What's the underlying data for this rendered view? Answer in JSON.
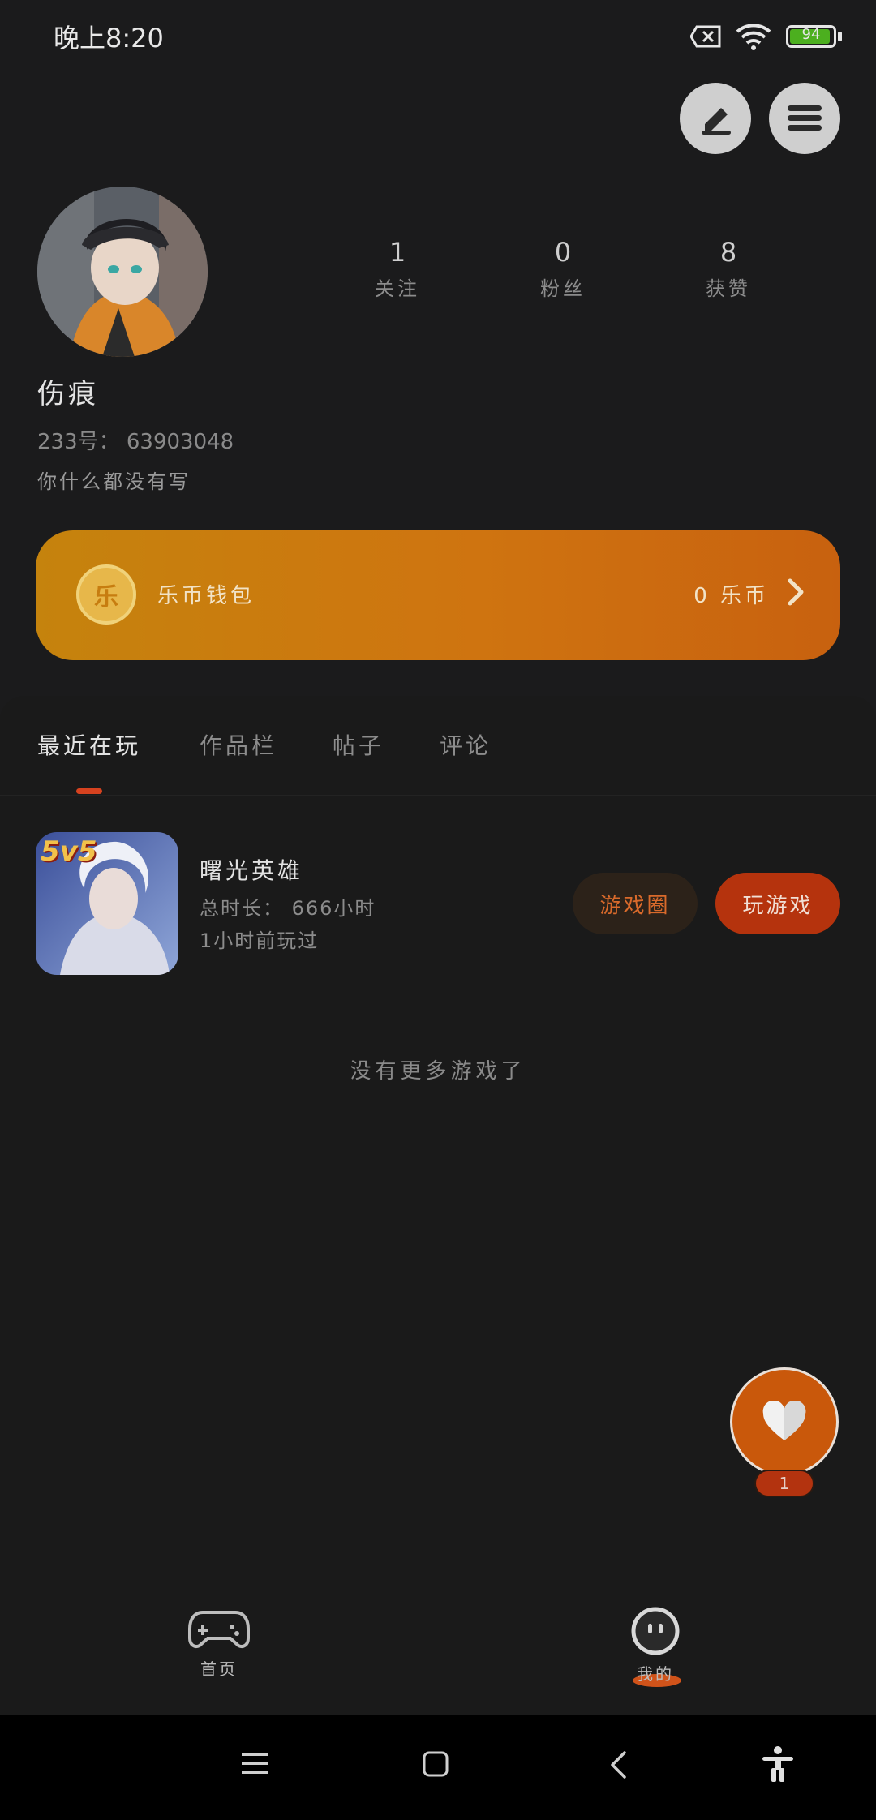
{
  "status_bar": {
    "time": "晚上8:20",
    "battery": "94",
    "battery_level": 0.94
  },
  "profile": {
    "username": "伤痕",
    "uid": "233号： 63903048",
    "bio": "你什么都没有写",
    "stats": [
      {
        "num": "1",
        "label": "关注"
      },
      {
        "num": "0",
        "label": "粉丝"
      },
      {
        "num": "8",
        "label": "获赞"
      }
    ]
  },
  "wallet": {
    "icon_text": "乐",
    "label": "乐币钱包",
    "balance": "0 乐币"
  },
  "tabs": [
    "最近在玩",
    "作品栏",
    "帖子",
    "评论"
  ],
  "game": {
    "badge": "5v5",
    "title": "曙光英雄",
    "duration": "总时长： 666小时",
    "last_played": "1小时前玩过",
    "circle_label": "游戏圈",
    "play_label": "玩游戏"
  },
  "no_more": "没有更多游戏了",
  "fab": {
    "badge": "1"
  },
  "bottom_nav": {
    "home": "首页",
    "mine": "我的"
  },
  "colors": {
    "accent": "#d6421f",
    "wallet_start": "#c5830d",
    "wallet_end": "#c8610f",
    "fab": "#c9580b"
  }
}
